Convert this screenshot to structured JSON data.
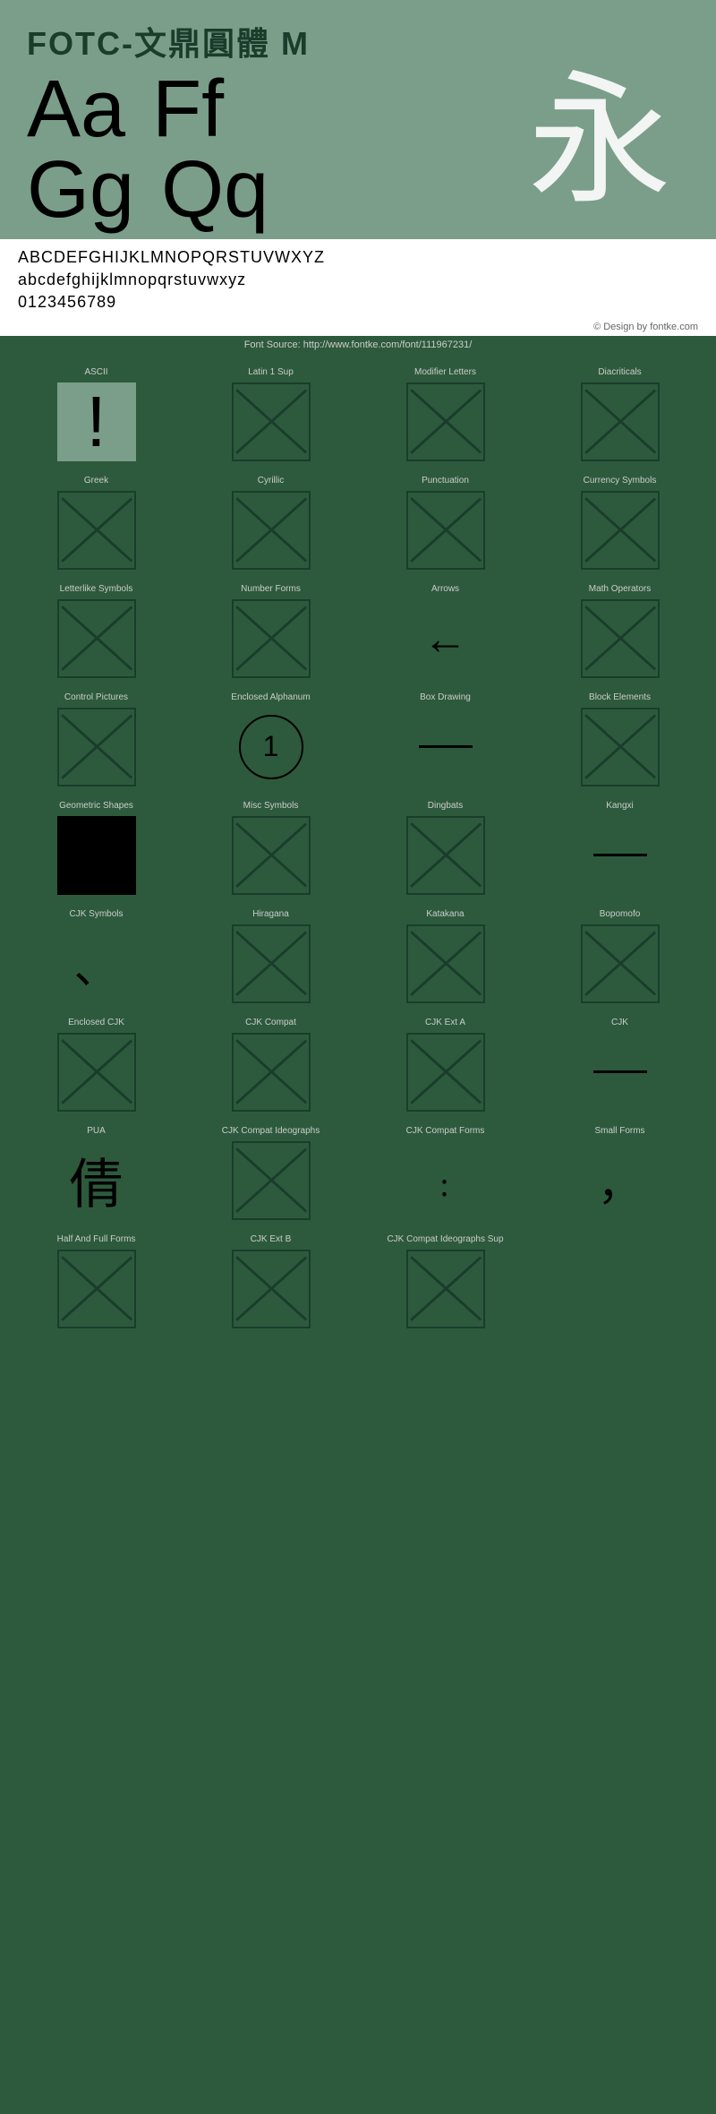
{
  "header": {
    "title": "FOTC-文鼎圓體 M",
    "latin_chars": [
      "Aa",
      "Ff",
      "Gg",
      "Qq"
    ],
    "cjk_char": "永",
    "alphabet_upper": "ABCDEFGHIJKLMNOPQRSTUVWXYZ",
    "alphabet_lower": "abcdefghijklmnopqrstuvwxyz",
    "digits": "0123456789",
    "copyright": "© Design by fontke.com",
    "source": "Font Source: http://www.fontke.com/font/111967231/"
  },
  "grid": {
    "rows": [
      [
        {
          "label": "ASCII",
          "type": "exclamation"
        },
        {
          "label": "Latin 1 Sup",
          "type": "placeholder"
        },
        {
          "label": "Modifier Letters",
          "type": "placeholder"
        },
        {
          "label": "Diacriticals",
          "type": "placeholder"
        }
      ],
      [
        {
          "label": "Greek",
          "type": "placeholder"
        },
        {
          "label": "Cyrillic",
          "type": "placeholder"
        },
        {
          "label": "Punctuation",
          "type": "placeholder"
        },
        {
          "label": "Currency Symbols",
          "type": "placeholder"
        }
      ],
      [
        {
          "label": "Letterlike Symbols",
          "type": "placeholder"
        },
        {
          "label": "Number Forms",
          "type": "placeholder"
        },
        {
          "label": "Arrows",
          "type": "arrow"
        },
        {
          "label": "Math Operators",
          "type": "placeholder"
        }
      ],
      [
        {
          "label": "Control Pictures",
          "type": "placeholder"
        },
        {
          "label": "Enclosed Alphanum",
          "type": "circleone"
        },
        {
          "label": "Box Drawing",
          "type": "dash"
        },
        {
          "label": "Block Elements",
          "type": "placeholder"
        }
      ],
      [
        {
          "label": "Geometric Shapes",
          "type": "blacksquare"
        },
        {
          "label": "Misc Symbols",
          "type": "placeholder"
        },
        {
          "label": "Dingbats",
          "type": "placeholder"
        },
        {
          "label": "Kangxi",
          "type": "dash"
        }
      ],
      [
        {
          "label": "CJK Symbols",
          "type": "comma"
        },
        {
          "label": "Hiragana",
          "type": "placeholder"
        },
        {
          "label": "Katakana",
          "type": "placeholder"
        },
        {
          "label": "Bopomofo",
          "type": "placeholder"
        }
      ],
      [
        {
          "label": "Enclosed CJK",
          "type": "placeholder"
        },
        {
          "label": "CJK Compat",
          "type": "placeholder"
        },
        {
          "label": "CJK Ext A",
          "type": "placeholder"
        },
        {
          "label": "CJK",
          "type": "dash"
        }
      ],
      [
        {
          "label": "PUA",
          "type": "cjkchar"
        },
        {
          "label": "CJK Compat Ideographs",
          "type": "placeholder"
        },
        {
          "label": "CJK Compat Forms",
          "type": "colon"
        },
        {
          "label": "Small Forms",
          "type": "apostrophe"
        }
      ],
      [
        {
          "label": "Half And Full Forms",
          "type": "placeholder"
        },
        {
          "label": "CJK Ext B",
          "type": "placeholder"
        },
        {
          "label": "CJK Compat Ideographs Sup",
          "type": "placeholder"
        },
        {
          "label": "",
          "type": "empty"
        }
      ]
    ]
  }
}
